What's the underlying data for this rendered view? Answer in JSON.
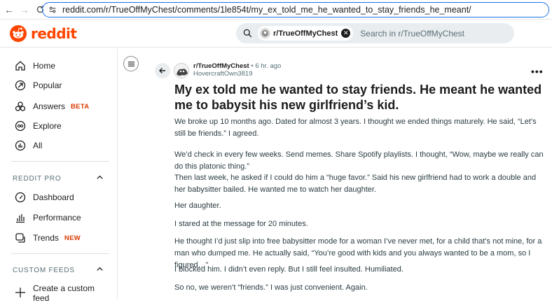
{
  "browser": {
    "url_host": "reddit.com",
    "url_path": "/r/TrueOffMyChest/comments/1le854t/my_ex_told_me_he_wanted_to_stay_friends_he_meant/"
  },
  "header": {
    "logo_text": "reddit",
    "search_chip": "r/TrueOffMyChest",
    "search_placeholder": "Search in r/TrueOffMyChest"
  },
  "sidebar": {
    "items": [
      {
        "label": "Home",
        "icon": "home-icon"
      },
      {
        "label": "Popular",
        "icon": "popular-icon"
      },
      {
        "label": "Answers",
        "icon": "answers-icon",
        "tag": "BETA"
      },
      {
        "label": "Explore",
        "icon": "explore-icon"
      },
      {
        "label": "All",
        "icon": "all-icon"
      }
    ],
    "reddit_pro": {
      "header": "REDDIT PRO",
      "items": [
        {
          "label": "Dashboard",
          "icon": "dashboard-icon"
        },
        {
          "label": "Performance",
          "icon": "performance-icon"
        },
        {
          "label": "Trends",
          "icon": "trends-icon",
          "tag": "NEW"
        }
      ]
    },
    "custom_feeds": {
      "header": "CUSTOM FEEDS",
      "create_label": "Create a custom feed"
    }
  },
  "post": {
    "subreddit": "r/TrueOffMyChest",
    "time": "• 6 hr. ago",
    "author": "HovercraftOwn3819",
    "title": "My ex told me he wanted to stay friends. He meant he wanted me to babysit his new girlfriend’s kid.",
    "paragraphs": [
      "We broke up 10 months ago. Dated for almost 3 years. I thought we ended things maturely. He said, “Let’s still be friends.” I agreed.",
      "We’d check in every few weeks. Send memes. Share Spotify playlists. I thought, “Wow, maybe we really can do this platonic thing.”",
      "Then last week, he asked if I could do him a “huge favor.” Said his new girlfriend had to work a double and her babysitter bailed. He wanted me to watch her daughter.",
      "Her daughter.",
      "I stared at the message for 20 minutes.",
      "He thought I’d just slip into free babysitter mode for a woman I’ve never met, for a child that’s not mine, for a man who dumped me. He actually said, “You’re good with kids and you always wanted to be a mom, so I figured…”",
      "I blocked him. I didn’t even reply. But I still feel insulted. Humiliated.",
      "So no, we weren’t “friends.” I was just convenient. Again."
    ]
  },
  "colors": {
    "brand": "#ff4500",
    "tag": "#d93900",
    "link_focus": "#1a73e8"
  }
}
